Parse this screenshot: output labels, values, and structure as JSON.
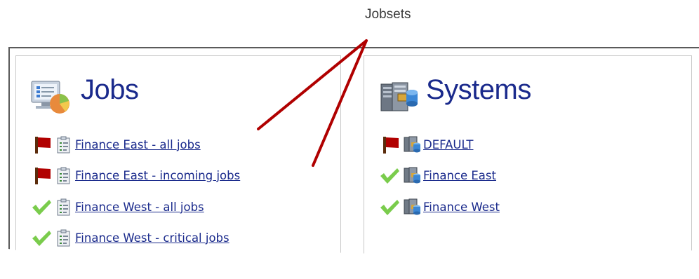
{
  "callout": {
    "label": "Jobsets"
  },
  "jobs": {
    "title": "Jobs",
    "icon": "jobs-monitor-pie-icon",
    "items": [
      {
        "label": "Finance East - all jobs",
        "status": "red-flag-icon",
        "icon": "jobset-clipboard-icon"
      },
      {
        "label": "Finance East - incoming jobs",
        "status": "red-flag-icon",
        "icon": "jobset-clipboard-icon"
      },
      {
        "label": "Finance West - all jobs",
        "status": "green-check-icon",
        "icon": "jobset-clipboard-icon"
      },
      {
        "label": "Finance West - critical jobs",
        "status": "green-check-icon",
        "icon": "jobset-clipboard-icon"
      }
    ]
  },
  "systems": {
    "title": "Systems",
    "icon": "systems-servers-icon",
    "items": [
      {
        "label": "DEFAULT",
        "status": "red-flag-icon",
        "icon": "system-server-icon"
      },
      {
        "label": "Finance East",
        "status": "green-check-icon",
        "icon": "system-server-icon"
      },
      {
        "label": "Finance West",
        "status": "green-check-icon",
        "icon": "system-server-icon"
      }
    ]
  },
  "colors": {
    "link": "#1a2a8c",
    "flag": "#a00000",
    "check": "#7acc4c",
    "callout_line": "#b00000"
  }
}
